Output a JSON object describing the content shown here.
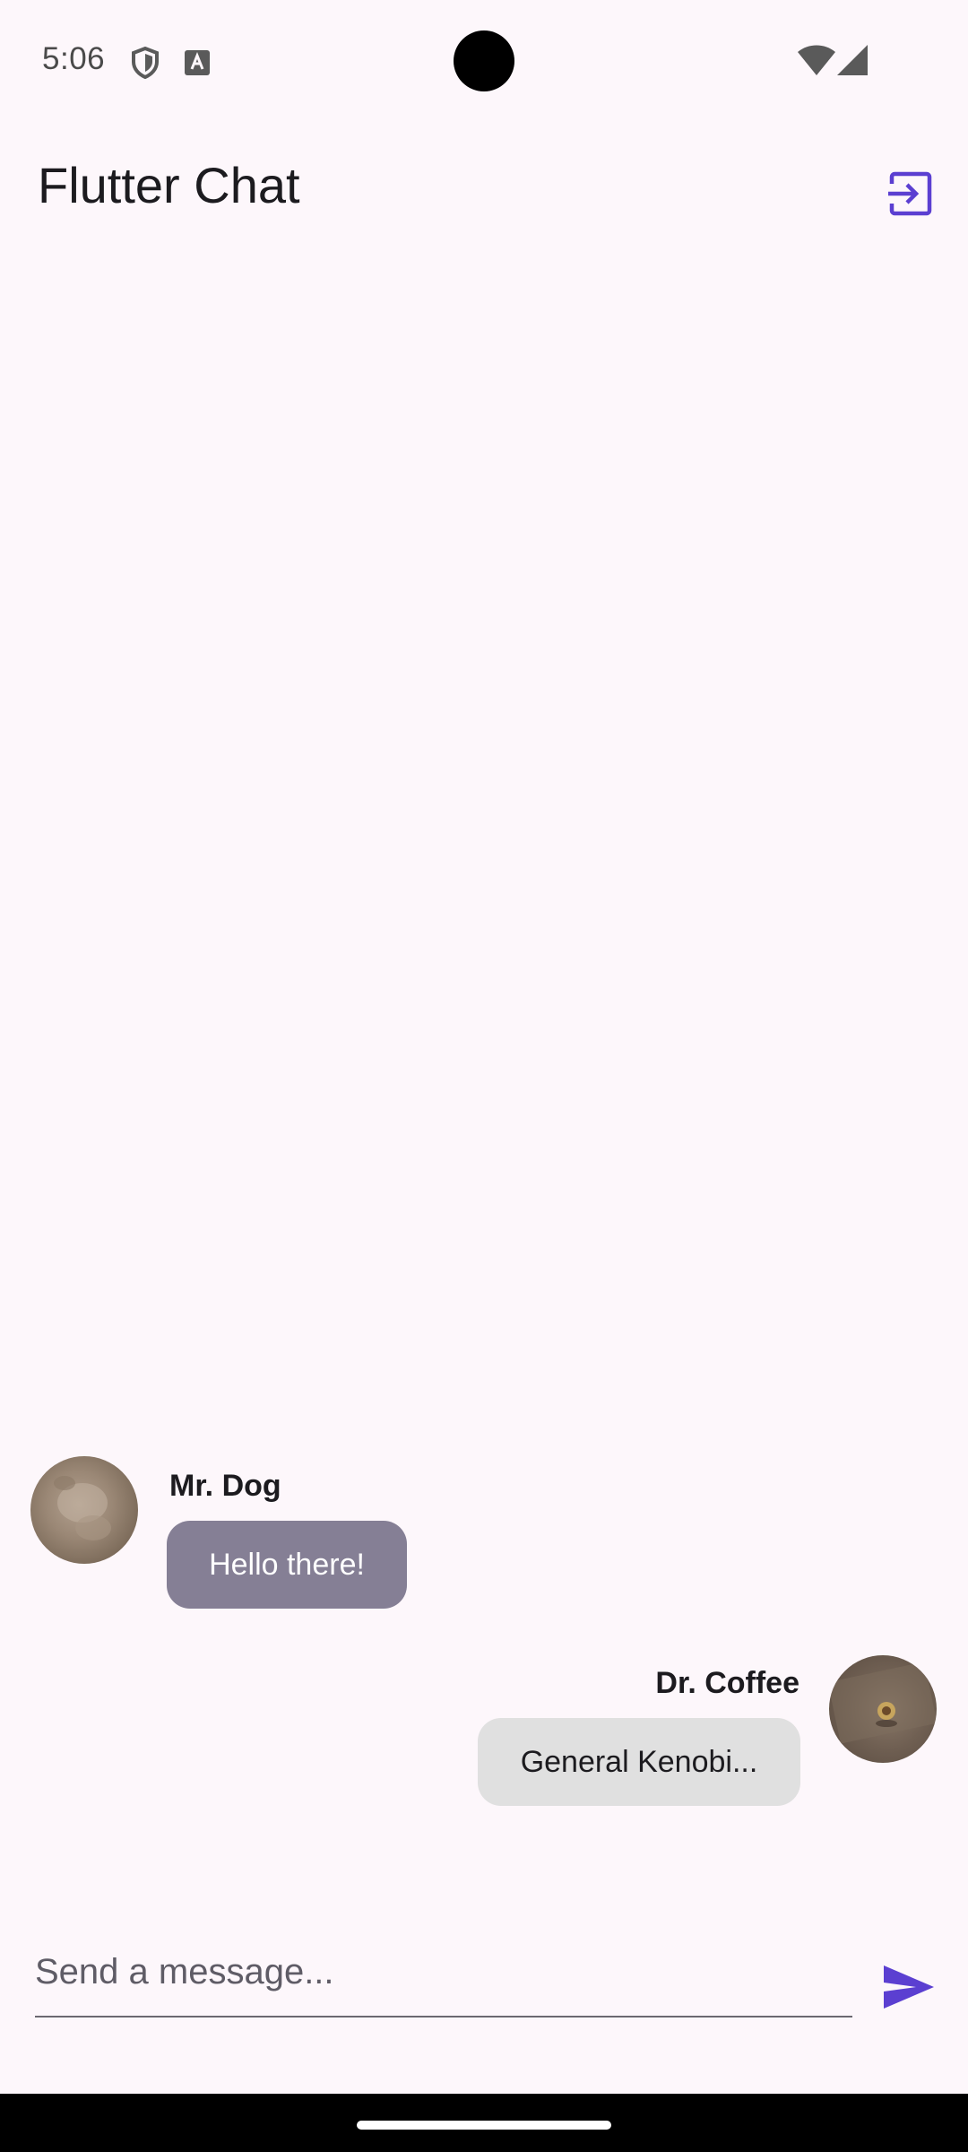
{
  "status_bar": {
    "time": "5:06",
    "icons": [
      "shield-icon",
      "keyboard-a-icon",
      "wifi-icon",
      "cellular-signal-icon"
    ]
  },
  "app_bar": {
    "title": "Flutter Chat",
    "action_icon": "logout-icon"
  },
  "colors": {
    "accent": "#5b3fd1",
    "background": "#fdf7fb",
    "bubble_other": "#857f95",
    "bubble_self": "#e0e0e0"
  },
  "messages": [
    {
      "sender": "Mr. Dog",
      "text": "Hello there!",
      "side": "left",
      "avatar": "dog-avatar"
    },
    {
      "sender": "Dr. Coffee",
      "text": "General Kenobi...",
      "side": "right",
      "avatar": "coffee-avatar"
    }
  ],
  "composer": {
    "placeholder": "Send a message...",
    "value": "",
    "send_icon": "send-icon"
  }
}
